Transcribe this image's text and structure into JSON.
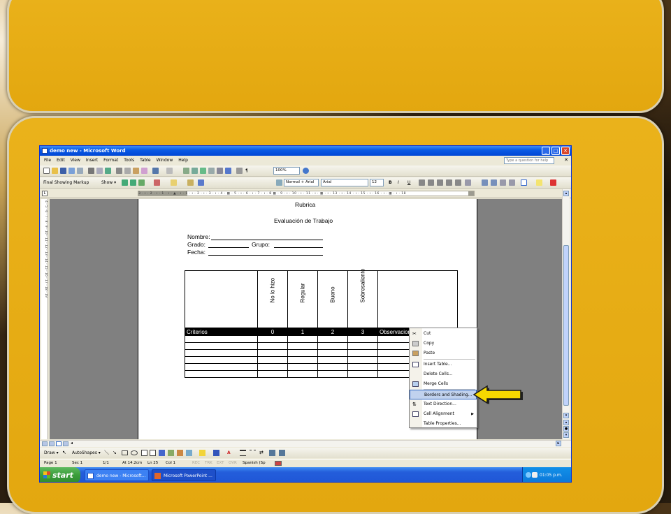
{
  "window": {
    "title": "demo new - Microsoft Word",
    "buttons": {
      "minimize": "_",
      "maximize": "□",
      "close": "✕"
    }
  },
  "menu": {
    "items": [
      "File",
      "Edit",
      "View",
      "Insert",
      "Format",
      "Tools",
      "Table",
      "Window",
      "Help"
    ],
    "help_placeholder": "Type a question for help",
    "close_doc": "✕"
  },
  "toolbar": {
    "zoom": "100%",
    "markup_mode": "Final Showing Markup",
    "show_label": "Show ▾",
    "style": "Normal + Arial",
    "font": "Arial",
    "font_size": "12",
    "bold": "B",
    "italic": "I",
    "underline": "U"
  },
  "ruler": {
    "horizontal": "3 · ı · 2 · ı · 1 · ı · ▲ · ı · 1 · ı · 2 · ı · 3 · ı · 4 · ▦ · 5 · ı · 6 · ı · 7 · ı · 8 ▦ · 9 · ı · 10 · ı · 11 · ı · ▦ · ı · 13 · ı · 14 · ı · 15 · ı · 16 · ı · ▦ · ı · 18",
    "vertical": "4 · 5 · 6 · 7 · 8 · 9 · 10 · 11 · 12 · 13 · 14 · 15 · 16 · 17 · 18 · 19"
  },
  "document": {
    "title": "Rubrica",
    "subtitle": "Evaluación de Trabajo",
    "fields": {
      "nombre": "Nombre:",
      "grado": "Grado:",
      "grupo": "Grupo:",
      "fecha": "Fecha:"
    },
    "table": {
      "column_headers": [
        "",
        "No lo hizo",
        "Regular",
        "Bueno",
        "Sobresaliente",
        ""
      ],
      "selected_row": [
        "Criterios",
        "0",
        "1",
        "2",
        "3",
        "Observaciones"
      ],
      "empty_rows": 6
    }
  },
  "context_menu": {
    "items": [
      {
        "label": "Cut",
        "icon": "scissors-icon"
      },
      {
        "label": "Copy",
        "icon": "copy-icon"
      },
      {
        "label": "Paste",
        "icon": "paste-icon"
      },
      {
        "label": "Insert Table...",
        "icon": "table-icon"
      },
      {
        "label": "Delete Cells...",
        "icon": ""
      },
      {
        "label": "Merge Cells",
        "icon": "merge-cells-icon"
      },
      {
        "label": "Borders and Shading...",
        "icon": "",
        "highlighted": true
      },
      {
        "label": "Text Direction...",
        "icon": "text-direction-icon"
      },
      {
        "label": "Cell Alignment",
        "icon": "cell-alignment-icon",
        "submenu": true
      },
      {
        "label": "Table Properties...",
        "icon": ""
      }
    ]
  },
  "drawbar": {
    "draw": "Draw ▾",
    "autoshapes": "AutoShapes ▾"
  },
  "status": {
    "page": "Page 1",
    "sec": "Sec 1",
    "of": "1/1",
    "at": "At 14.2cm",
    "ln": "Ln 25",
    "col": "Col 1",
    "rec": "REC",
    "trk": "TRK",
    "ext": "EXT",
    "ovr": "OVR",
    "language": "Spanish (Sp"
  },
  "taskbar": {
    "start": "start",
    "tasks": [
      "demo new - Microsoft...",
      "Microsoft PowerPoint ..."
    ],
    "clock": "01:05 p.m."
  },
  "colors": {
    "panel": "#e6aa12",
    "titlebar": "#0a5be5",
    "selection": "#000000",
    "highlight": "#c1d2ee",
    "arrow": "#f5d800"
  }
}
